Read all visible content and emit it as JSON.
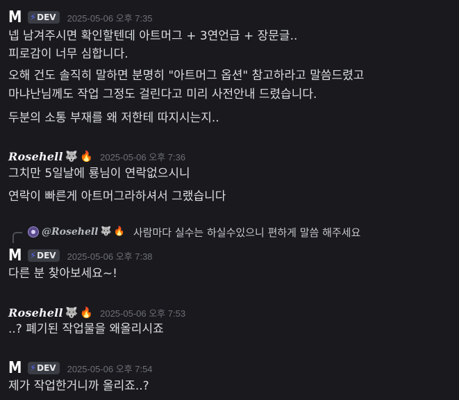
{
  "messages": [
    {
      "author": "M",
      "badge": "DEV",
      "badge_icon": "lightning-bolt-icon",
      "time": "2025-05-06 오후 7:35",
      "lines": [
        "넵 남겨주시면 확인할텐데 아트머그 + 3연언급 + 장문글..",
        "피로감이 너무 심합니다.",
        "오해 건도 솔직히 말하면 분명히 \"아트머그 옵션\" 참고하라고 말씀드렸고",
        "마냐난님께도 작업 그정도 걸린다고 미리 사전안내 드렸습니다.",
        "두분의 소통 부재를 왜 저한테 따지시는지.."
      ]
    },
    {
      "author": "Rosehell",
      "emojis": [
        "wolf-icon",
        "fire-icon"
      ],
      "time": "2025-05-06 오후 7:36",
      "lines": [
        "그치만 5일날에 룡님이 연락없으시니",
        "연락이 빠른게 아트머그라하셔서 그랬습니다"
      ]
    },
    {
      "author": "M",
      "badge": "DEV",
      "badge_icon": "lightning-bolt-icon",
      "time": "2025-05-06 오후 7:38",
      "reply": {
        "name": "@Rosehell",
        "text": "사람마다 실수는 하실수있으니 편하게 말씀 해주세요"
      },
      "lines": [
        "다른 분 찾아보세요~!"
      ]
    },
    {
      "author": "Rosehell",
      "emojis": [
        "wolf-icon",
        "fire-icon"
      ],
      "time": "2025-05-06 오후 7:53",
      "lines": [
        "..? 폐기된 작업물을 왜올리시죠"
      ]
    },
    {
      "author": "M",
      "badge": "DEV",
      "badge_icon": "lightning-bolt-icon",
      "time": "2025-05-06 오후 7:54",
      "lines": [
        "제가 작업한거니까 올리죠..?"
      ]
    }
  ],
  "colors": {
    "background": "#1a1a1e",
    "text": "#dbdee1",
    "timestamp": "#6d6f78",
    "badge_bg": "#3b3d45",
    "bolt": "#5865f2"
  }
}
